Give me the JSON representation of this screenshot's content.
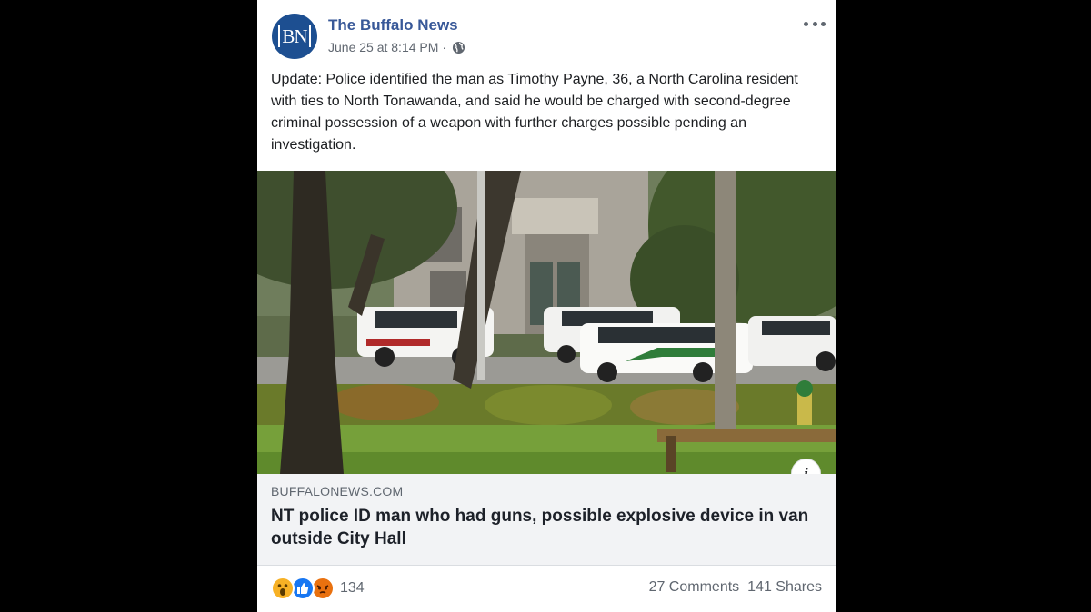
{
  "post": {
    "page_name": "The Buffalo News",
    "avatar_text": "BN",
    "timestamp": "June 25 at 8:14 PM",
    "separator": "·",
    "text": "Update: Police identified the man as Timothy Payne, 36, a North Carolina resident with ties to North Tonawanda, and said he would be charged with second-degree criminal possession of a weapon with further charges possible pending an investigation."
  },
  "link": {
    "domain": "BUFFALONEWS.COM",
    "headline": "NT police ID man who had guns, possible explosive device in van outside City Hall",
    "info_label": "i"
  },
  "engagement": {
    "reaction_icons": [
      "wow-reaction-icon",
      "like-reaction-icon",
      "angry-reaction-icon"
    ],
    "reaction_count": "134",
    "comments": "27 Comments",
    "shares": "141 Shares"
  },
  "colors": {
    "page_name": "#385898",
    "avatar_bg": "#1d4f91",
    "link_box_bg": "#f2f3f5"
  }
}
